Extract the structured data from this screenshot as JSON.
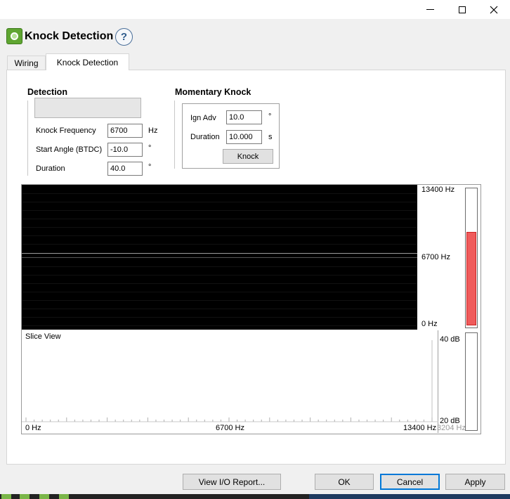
{
  "window": {
    "minimize_glyph": "—",
    "maximize_glyph": "☐",
    "close_glyph": "✕"
  },
  "header": {
    "title": "Knock Detection",
    "help_glyph": "?"
  },
  "tabs": [
    {
      "label": "Wiring",
      "active": false
    },
    {
      "label": "Knock Detection",
      "active": true
    }
  ],
  "detection": {
    "title": "Detection",
    "status_text": "",
    "fields": [
      {
        "label": "Knock Frequency",
        "value": "6700",
        "unit": "Hz"
      },
      {
        "label": "Start Angle (BTDC)",
        "value": "-10.0",
        "unit": "°"
      },
      {
        "label": "Duration",
        "value": "40.0",
        "unit": "°"
      }
    ]
  },
  "momentary": {
    "title": "Momentary Knock",
    "fields": [
      {
        "label": "Ign Adv",
        "value": "10.0",
        "unit": "°"
      },
      {
        "label": "Duration",
        "value": "10.000",
        "unit": "s"
      }
    ],
    "knock_button": "Knock"
  },
  "spectrogram": {
    "freq_labels": {
      "top": "13400 Hz",
      "mid": "6700 Hz",
      "bottom": "0 Hz"
    },
    "colorbar_level": 0.68,
    "colorbar_color": "#ef5b5b"
  },
  "slice_view": {
    "title": "Slice View",
    "y_labels": {
      "top": "40 dB",
      "bottom": "20 dB"
    },
    "x_labels": {
      "left": "0 Hz",
      "mid": "6700 Hz",
      "right": "13400 Hz",
      "faded": "3204 Hz"
    }
  },
  "footer": {
    "view_io": "View I/O Report...",
    "ok": "OK",
    "cancel": "Cancel",
    "apply": "Apply"
  }
}
